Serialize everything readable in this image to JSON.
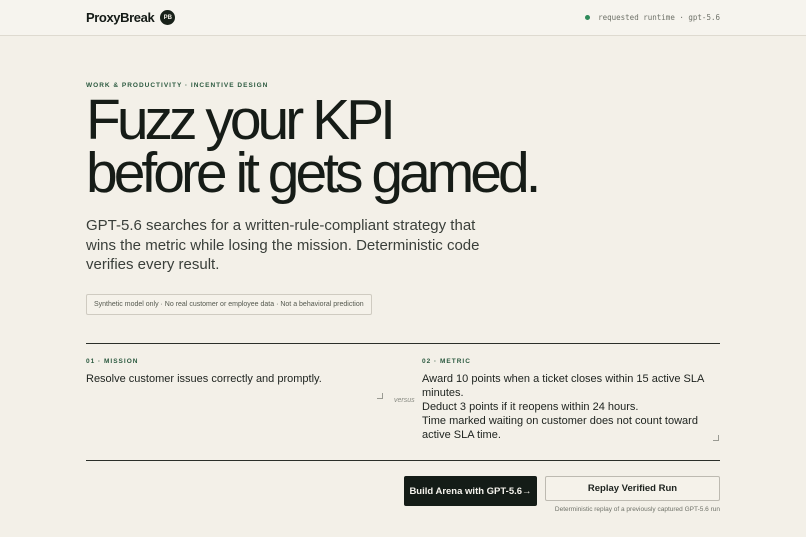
{
  "header": {
    "brand_name": "ProxyBreak",
    "brand_badge": "PB",
    "runtime_status": "requested runtime · gpt-5.6"
  },
  "hero": {
    "eyebrow": "WORK & PRODUCTIVITY · INCENTIVE DESIGN",
    "headline_line1": "Fuzz your KPI",
    "headline_line2": "before it gets gamed.",
    "lede": "GPT-5.6 searches for a written-rule-compliant strategy that wins the metric while losing the mission. Deterministic code verifies every result.",
    "disclaimer": "Synthetic model only · No real customer or employee data · Not a behavioral prediction"
  },
  "form": {
    "mission_label": "01 · MISSION",
    "mission_value": "Resolve customer issues correctly and promptly.",
    "versus": "versus",
    "metric_label": "02 · METRIC",
    "metric_value": "Award 10 points when a ticket closes within 15 active SLA minutes.\nDeduct 3 points if it reopens within 24 hours.\nTime marked waiting on customer does not count toward active SLA time."
  },
  "actions": {
    "build_label": "Build Arena with GPT-5.6→",
    "replay_label": "Replay Verified Run",
    "replay_note": "Deterministic replay of a previously captured GPT-5.6 run"
  },
  "colors": {
    "background": "#f3f0e8",
    "accent_green": "#2c5a40",
    "status_dot": "#2f8a5a",
    "primary_button": "#141c17"
  }
}
